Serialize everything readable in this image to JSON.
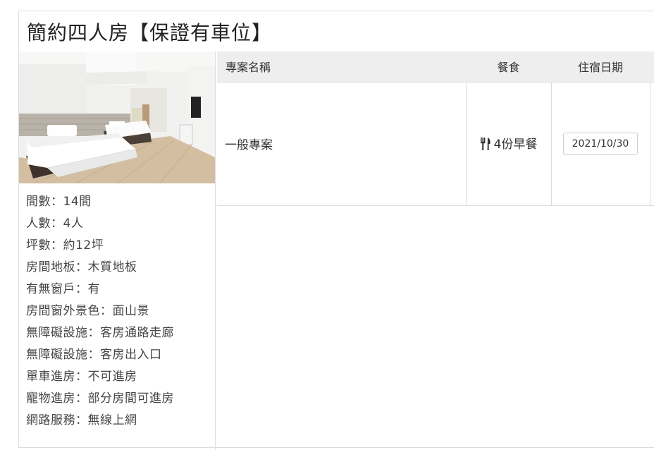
{
  "room": {
    "title": "簡約四人房【保證有車位】",
    "photo_alt": "簡約四人房",
    "info": [
      "間數：14間",
      "人數：4人",
      "坪數：約12坪",
      "房間地板：木質地板",
      "有無窗戶：有",
      "房間窗外景色：面山景",
      "無障礙設施：客房通路走廊",
      "無障礙設施：客房出入口",
      "單車進房：不可進房",
      "寵物進房：部分房間可進房",
      "網路服務：無線上網"
    ]
  },
  "plans": {
    "headers": {
      "name": "專案名稱",
      "meal": "餐食",
      "date": "住宿日期"
    },
    "rows": [
      {
        "name": "一般專案",
        "meal": "4份早餐",
        "meal_icon": "fork-knife-icon",
        "date": "2021/10/30"
      }
    ]
  }
}
